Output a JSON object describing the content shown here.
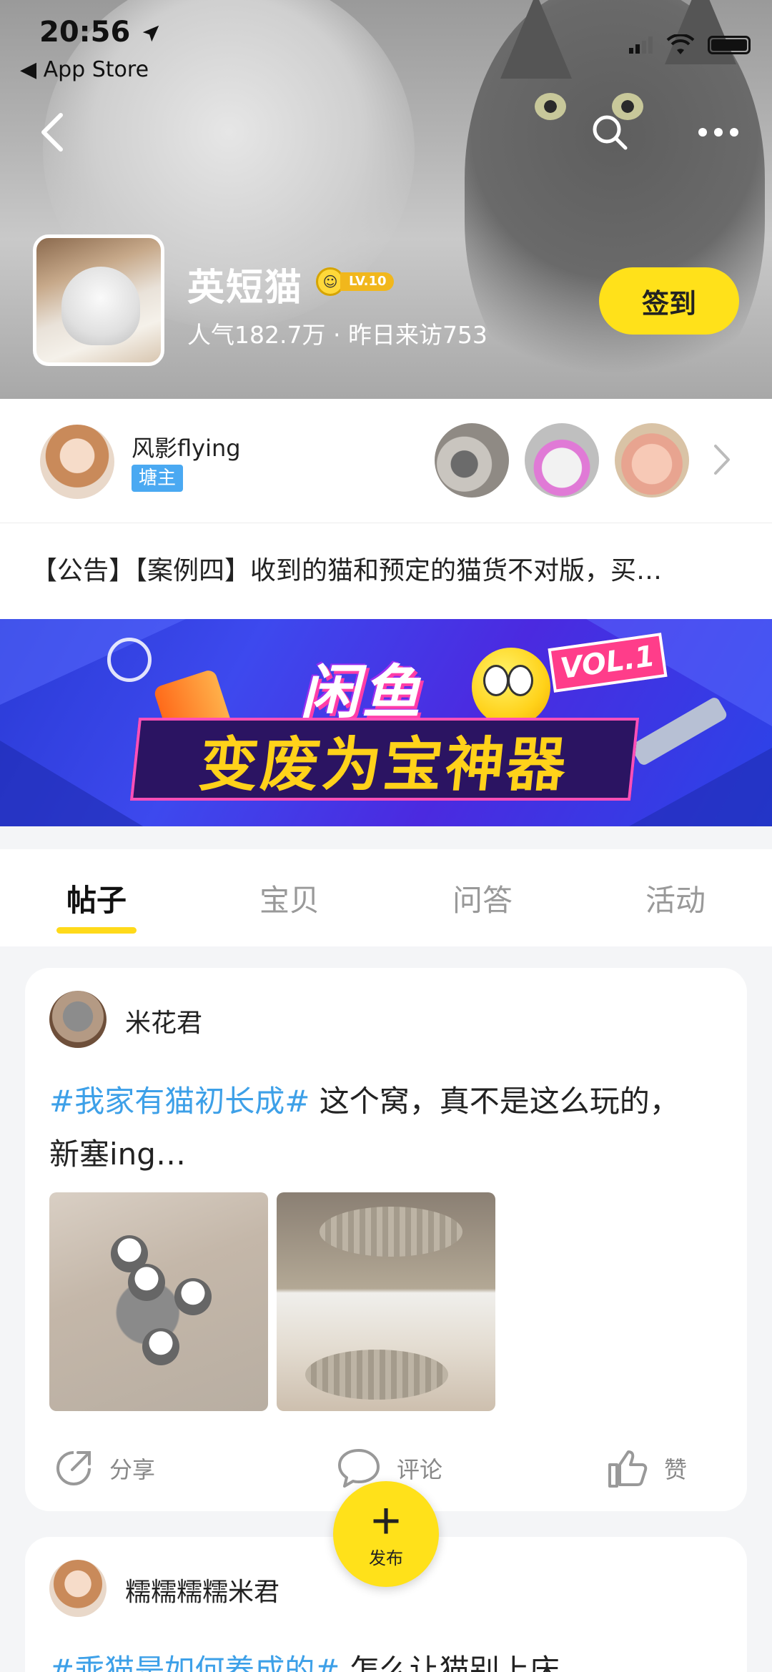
{
  "status_bar": {
    "time": "20:56",
    "back_app": "◀ App Store"
  },
  "group": {
    "name": "英短猫",
    "level": "LV.10",
    "stats": "人气182.7万 · 昨日来访753",
    "checkin_label": "签到"
  },
  "owner": {
    "name": "风影flying",
    "role": "塘主"
  },
  "notice": "【公告】【案例四】收到的猫和预定的猫货不对版，买…",
  "banner": {
    "line1": "闲鱼",
    "line2": "变废为宝神器",
    "badge": "VOL.1"
  },
  "tabs": [
    {
      "label": "帖子",
      "active": true
    },
    {
      "label": "宝贝",
      "active": false
    },
    {
      "label": "问答",
      "active": false
    },
    {
      "label": "活动",
      "active": false
    }
  ],
  "posts": [
    {
      "author": "米花君",
      "hashtag": "#我家有猫初长成#",
      "text": " 这个窝，真不是这么玩的，新塞ing…",
      "actions": {
        "share": "分享",
        "comment": "评论",
        "like": "赞"
      }
    },
    {
      "author": "糯糯糯糯米君",
      "hashtag": "#乖猫是如何养成的#",
      "text": " 怎么让猫别上床"
    }
  ],
  "fab": {
    "label": "发布"
  },
  "colors": {
    "accent_yellow": "#ffe11a",
    "tag_blue": "#3da0e8",
    "badge_blue": "#4aa9f2"
  }
}
